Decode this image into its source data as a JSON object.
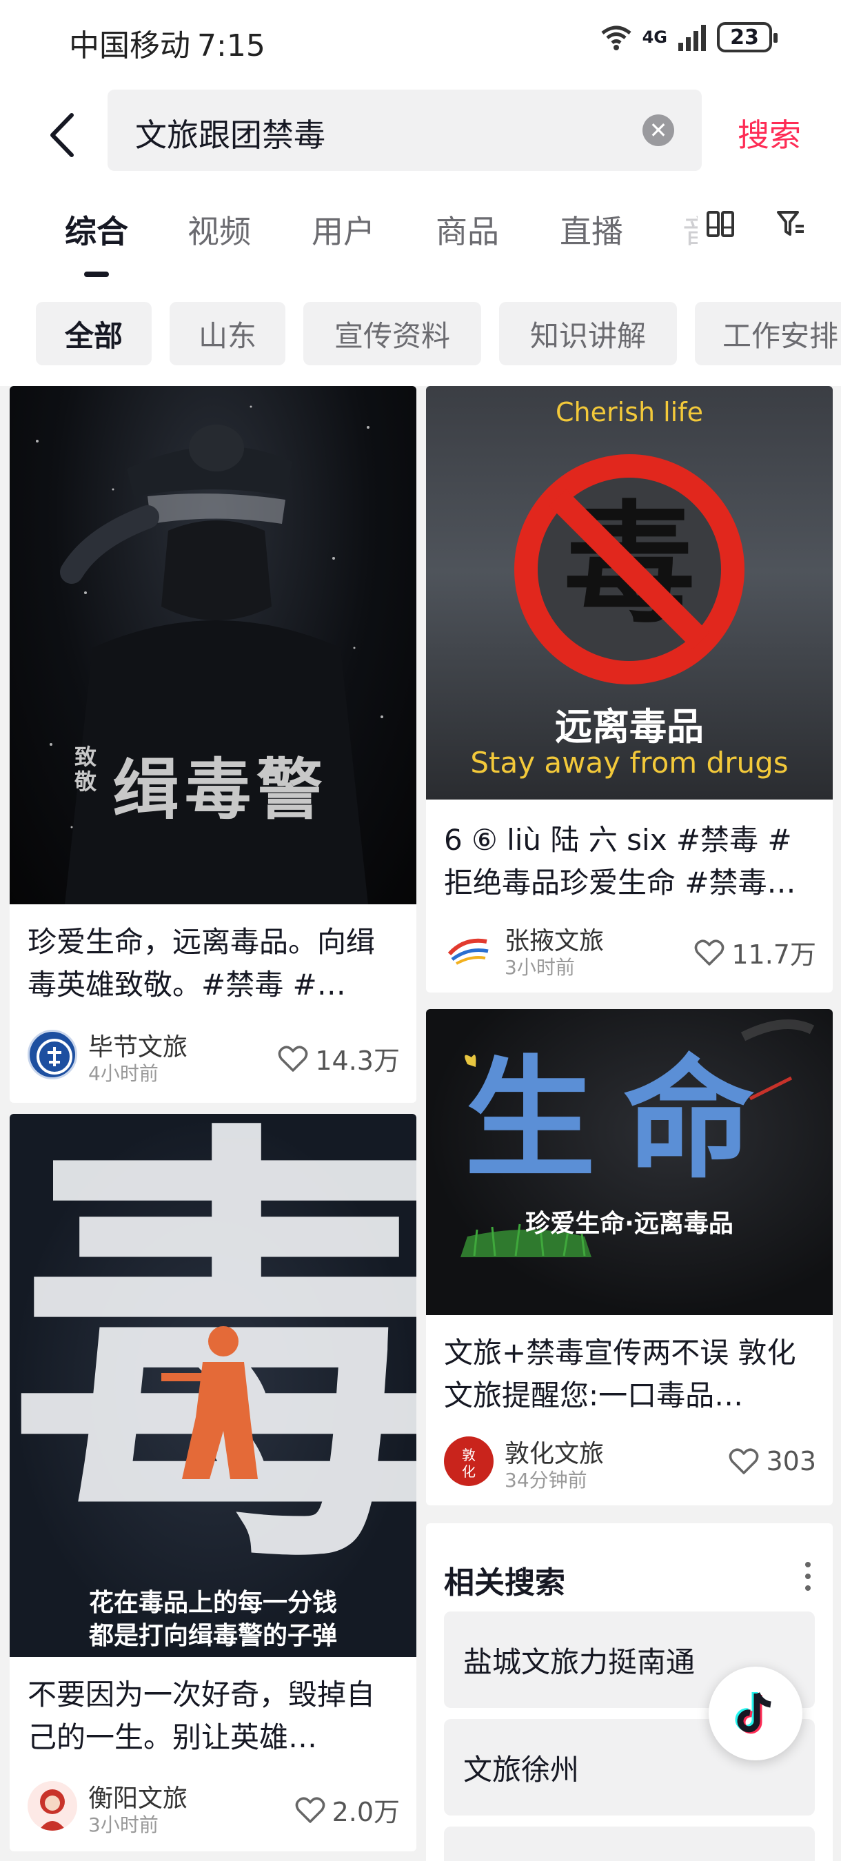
{
  "status_bar": {
    "carrier": "中国移动",
    "time": "7:15",
    "network": "4G",
    "battery": "23"
  },
  "search": {
    "query": "文旅跟团禁毒",
    "submit_label": "搜索"
  },
  "tabs": [
    {
      "label": "综合",
      "active": true
    },
    {
      "label": "视频"
    },
    {
      "label": "用户"
    },
    {
      "label": "商品"
    },
    {
      "label": "直播"
    },
    {
      "label": "音"
    }
  ],
  "chips": [
    {
      "label": "全部",
      "active": true
    },
    {
      "label": "山东"
    },
    {
      "label": "宣传资料"
    },
    {
      "label": "知识讲解"
    },
    {
      "label": "工作安排"
    }
  ],
  "posts": [
    {
      "thumb_text_small": "致敬",
      "thumb_text_big": "缉毒警",
      "title": "珍爱生命，远离毒品。向缉毒英雄致敬。#禁毒 #…",
      "author": "毕节文旅",
      "ago": "4小时前",
      "likes": "14.3万"
    },
    {
      "thumb_text_en_top": "Cherish life",
      "thumb_text_cn": "远离毒品",
      "thumb_text_en": "Stay away from drugs",
      "sign_char": "毒",
      "title": "6 ⑥ liù 陆 六 six #禁毒 #拒绝毒品珍爱生命 #禁毒…",
      "author": "张掖文旅",
      "ago": "3小时前",
      "likes": "11.7万"
    },
    {
      "thumb_text_big": "生命",
      "thumb_caption": "珍爱生命·远离毒品",
      "title": "文旅+禁毒宣传两不误 敦化文旅提醒您:一口毒品…",
      "author": "敦化文旅",
      "ago": "34分钟前",
      "likes": "303"
    },
    {
      "thumb_char": "毒",
      "thumb_caption_line1": "花在毒品上的每一分钱",
      "thumb_caption_line2": "都是打向缉毒警的子弹",
      "title": "不要因为一次好奇，毁掉自己的一生。别让英雄…",
      "author": "衡阳文旅",
      "ago": "3小时前",
      "likes": "2.0万"
    }
  ],
  "related": {
    "title": "相关搜索",
    "items": [
      "盐城文旅力挺南通",
      "文旅徐州"
    ]
  },
  "colors": {
    "accent": "#fe2c55",
    "text": "#161823",
    "chip_bg": "#f1f1f2"
  }
}
